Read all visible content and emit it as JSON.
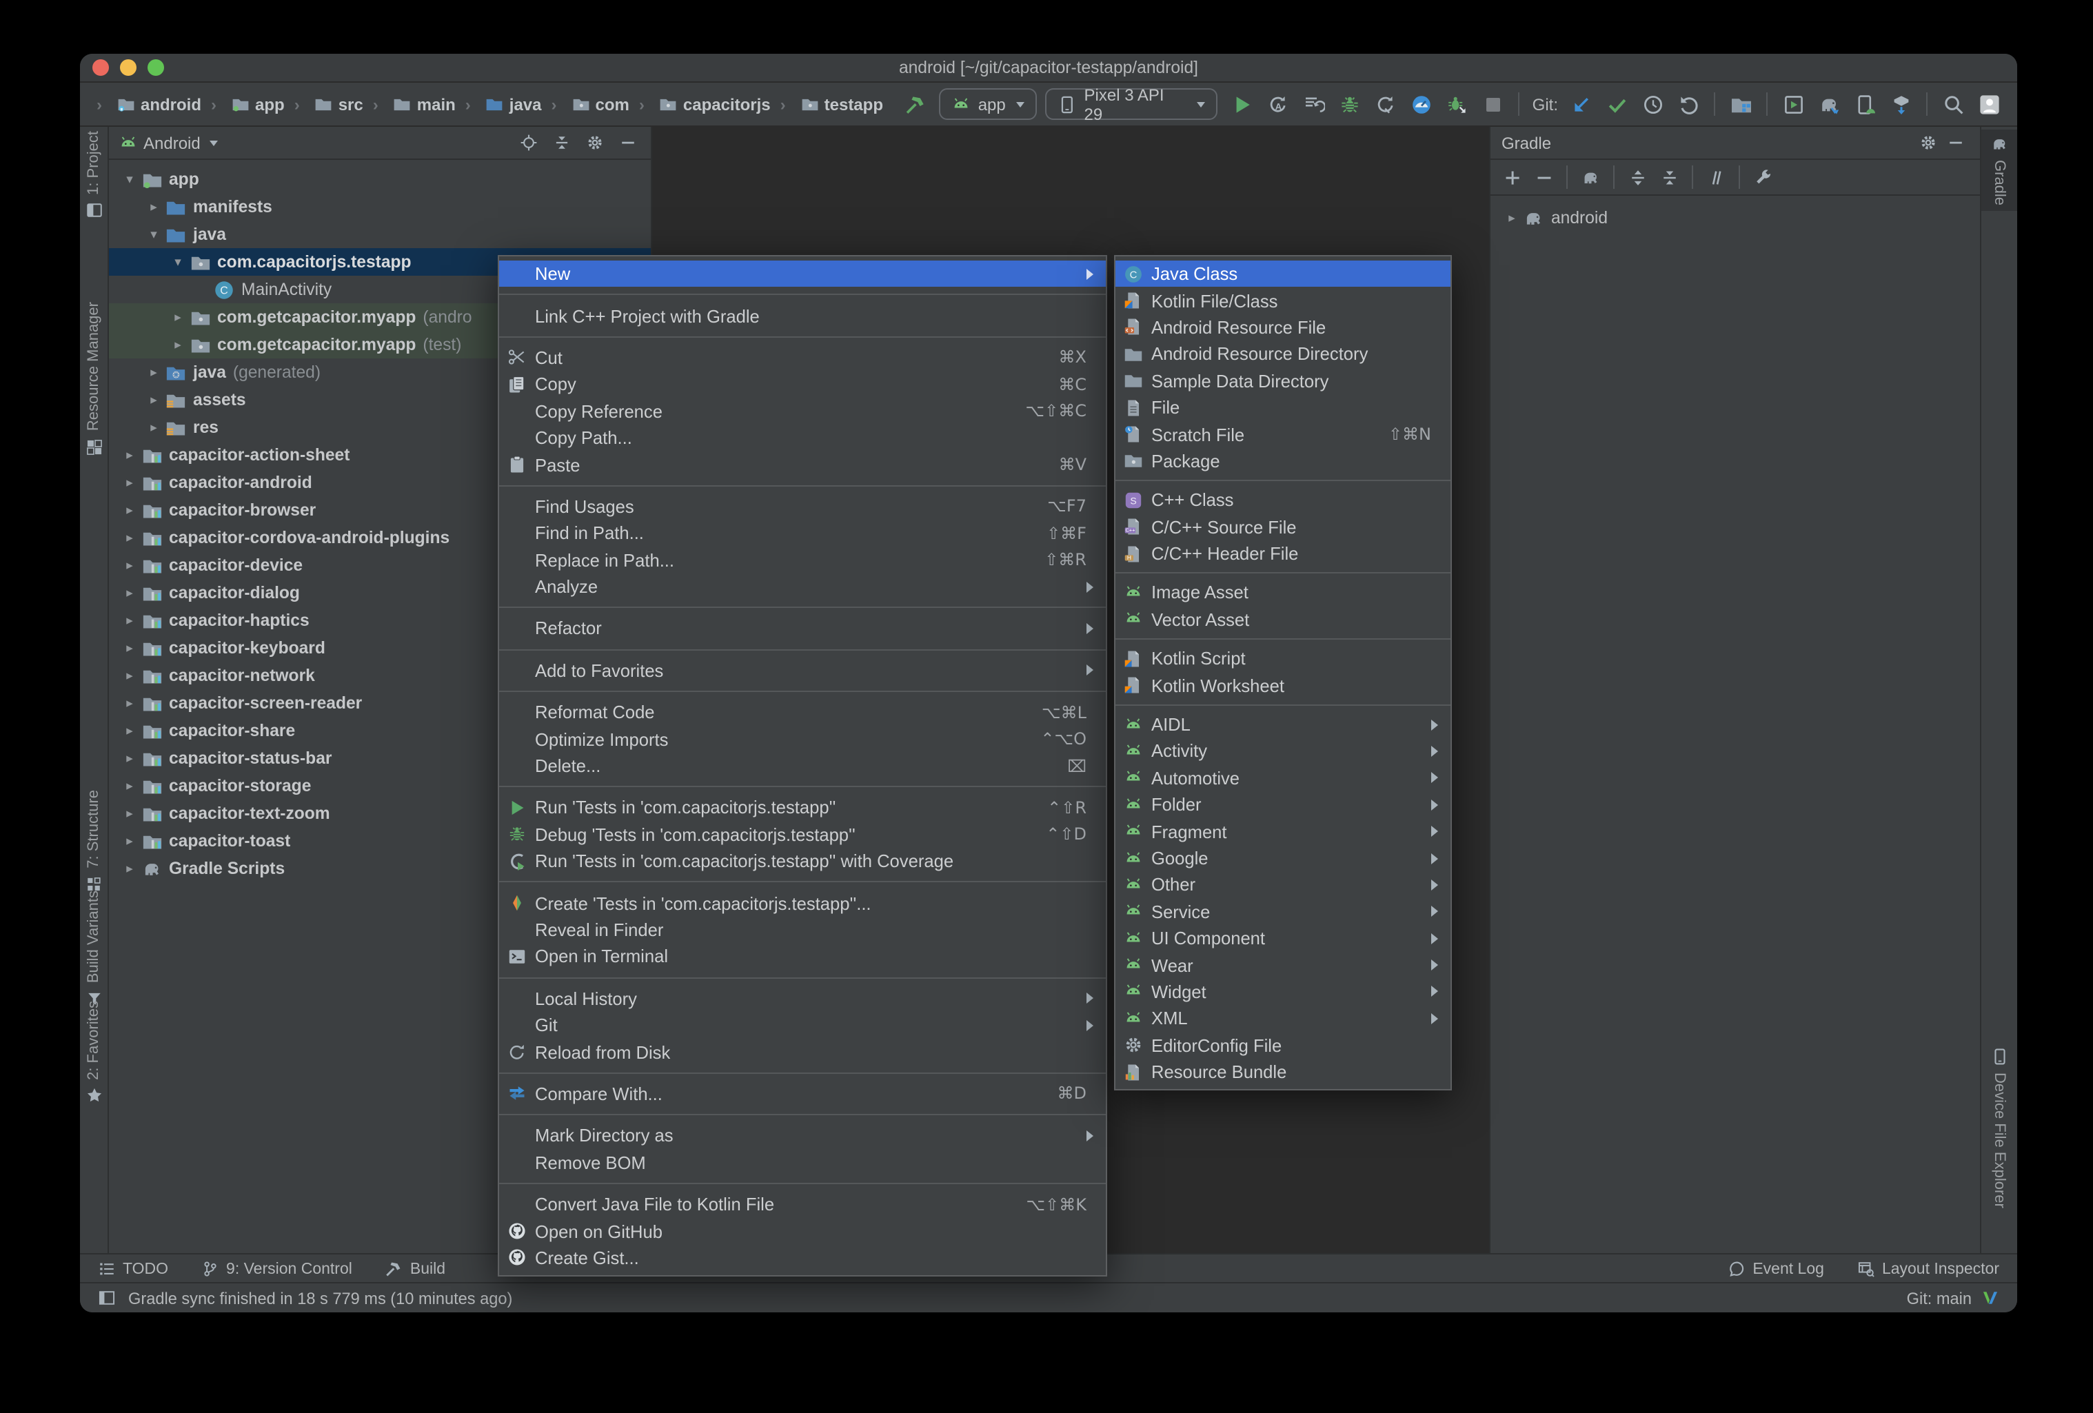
{
  "window": {
    "title": "android [~/git/capacitor-testapp/android]"
  },
  "colors": {
    "menu_selection": "#3a6bd0",
    "tree_selection": "#113150",
    "test_source_row": "#3f4a41",
    "run_green": "#59A869",
    "editor_bg": "#2b2b2b",
    "panel_bg": "#3c3f41"
  },
  "toolbar": {
    "breadcrumb": [
      {
        "icon": "folder-android",
        "label": "android"
      },
      {
        "icon": "folder-app",
        "label": "app"
      },
      {
        "icon": "folder",
        "label": "src"
      },
      {
        "icon": "folder",
        "label": "main"
      },
      {
        "icon": "folder-blue",
        "label": "java"
      },
      {
        "icon": "package",
        "label": "com"
      },
      {
        "icon": "package",
        "label": "capacitorjs"
      },
      {
        "icon": "package",
        "label": "testapp"
      }
    ],
    "run_config": "app",
    "device": "Pixel 3 API 29",
    "actions": [
      {
        "icon": "play",
        "name": "run-button"
      },
      {
        "icon": "apply-restart",
        "name": "apply-changes-restart-button"
      },
      {
        "icon": "apply-code",
        "name": "apply-code-changes-button"
      },
      {
        "icon": "debug",
        "name": "debug-button"
      },
      {
        "icon": "profiler-attach",
        "name": "attach-profiler-button"
      },
      {
        "icon": "profile",
        "name": "profile-button"
      },
      {
        "icon": "debug-attach",
        "name": "attach-debugger-button"
      },
      {
        "icon": "stop",
        "name": "stop-button"
      },
      {
        "type": "sep"
      },
      {
        "type": "label",
        "label": "Git:"
      },
      {
        "icon": "git-update",
        "name": "git-update-button"
      },
      {
        "icon": "git-commit",
        "name": "git-commit-button"
      },
      {
        "icon": "clock",
        "name": "git-history-button"
      },
      {
        "icon": "undo",
        "name": "git-rollback-button"
      },
      {
        "type": "sep"
      },
      {
        "icon": "sdk-folder",
        "name": "project-structure-button"
      },
      {
        "type": "sep"
      },
      {
        "icon": "device-manager",
        "name": "device-manager-button"
      },
      {
        "icon": "gradle-sync",
        "name": "gradle-sync-button"
      },
      {
        "icon": "avd-phone",
        "name": "avd-manager-button"
      },
      {
        "icon": "sdk-box",
        "name": "sdk-manager-button"
      },
      {
        "type": "sep"
      },
      {
        "icon": "search",
        "name": "search-everywhere-button"
      },
      {
        "icon": "avatar",
        "name": "avatar"
      }
    ]
  },
  "stripes": {
    "left": [
      {
        "icon": "project-tab",
        "label": "1: Project"
      },
      {
        "icon": "resource-manager",
        "label": "Resource Manager"
      },
      {
        "icon": "structure",
        "label": "7: Structure"
      },
      {
        "icon": "build-variants",
        "label": "Build Variants"
      },
      {
        "icon": "star",
        "label": "2: Favorites"
      }
    ],
    "right": [
      {
        "icon": "elephant",
        "label": "Gradle"
      },
      {
        "icon": "phone",
        "label": "Device File Explorer"
      }
    ]
  },
  "project_panel": {
    "view": "Android",
    "tree": [
      {
        "arrow": "▾",
        "icon": "folder-app",
        "label": "app",
        "bold": true,
        "level": 0
      },
      {
        "arrow": "▸",
        "icon": "folder-blue",
        "label": "manifests",
        "bold": true,
        "level": 1
      },
      {
        "arrow": "▾",
        "icon": "folder-blue",
        "label": "java",
        "bold": true,
        "level": 1
      },
      {
        "arrow": "▾",
        "icon": "package",
        "label": "com.capacitorjs.testapp",
        "bold": true,
        "level": 2,
        "selected": true
      },
      {
        "arrow": "",
        "icon": "class",
        "label": "MainActivity",
        "level": 3
      },
      {
        "arrow": "▸",
        "icon": "package",
        "label": "com.getcapacitor.myapp",
        "suffix": "(andro",
        "bold": true,
        "level": 2,
        "tinted": true
      },
      {
        "arrow": "▸",
        "icon": "package",
        "label": "com.getcapacitor.myapp",
        "suffix": "(test)",
        "bold": true,
        "level": 2,
        "tinted": true
      },
      {
        "arrow": "▸",
        "icon": "folder-gen",
        "label": "java",
        "suffix": "(generated)",
        "bold": true,
        "level": 1
      },
      {
        "arrow": "▸",
        "icon": "folder-res",
        "label": "assets",
        "bold": true,
        "level": 1
      },
      {
        "arrow": "▸",
        "icon": "folder-res",
        "label": "res",
        "bold": true,
        "level": 1
      },
      {
        "arrow": "▸",
        "icon": "module",
        "label": "capacitor-action-sheet",
        "bold": true,
        "level": 0
      },
      {
        "arrow": "▸",
        "icon": "module",
        "label": "capacitor-android",
        "bold": true,
        "level": 0
      },
      {
        "arrow": "▸",
        "icon": "module",
        "label": "capacitor-browser",
        "bold": true,
        "level": 0
      },
      {
        "arrow": "▸",
        "icon": "module",
        "label": "capacitor-cordova-android-plugins",
        "bold": true,
        "level": 0
      },
      {
        "arrow": "▸",
        "icon": "module",
        "label": "capacitor-device",
        "bold": true,
        "level": 0
      },
      {
        "arrow": "▸",
        "icon": "module",
        "label": "capacitor-dialog",
        "bold": true,
        "level": 0
      },
      {
        "arrow": "▸",
        "icon": "module",
        "label": "capacitor-haptics",
        "bold": true,
        "level": 0
      },
      {
        "arrow": "▸",
        "icon": "module",
        "label": "capacitor-keyboard",
        "bold": true,
        "level": 0
      },
      {
        "arrow": "▸",
        "icon": "module",
        "label": "capacitor-network",
        "bold": true,
        "level": 0
      },
      {
        "arrow": "▸",
        "icon": "module",
        "label": "capacitor-screen-reader",
        "bold": true,
        "level": 0
      },
      {
        "arrow": "▸",
        "icon": "module",
        "label": "capacitor-share",
        "bold": true,
        "level": 0
      },
      {
        "arrow": "▸",
        "icon": "module",
        "label": "capacitor-status-bar",
        "bold": true,
        "level": 0
      },
      {
        "arrow": "▸",
        "icon": "module",
        "label": "capacitor-storage",
        "bold": true,
        "level": 0
      },
      {
        "arrow": "▸",
        "icon": "module",
        "label": "capacitor-text-zoom",
        "bold": true,
        "level": 0
      },
      {
        "arrow": "▸",
        "icon": "module",
        "label": "capacitor-toast",
        "bold": true,
        "level": 0
      },
      {
        "arrow": "▸",
        "icon": "elephant",
        "label": "Gradle Scripts",
        "bold": true,
        "level": 0
      }
    ]
  },
  "gradle_panel": {
    "title": "Gradle",
    "root_arrow": "▸",
    "root": "android",
    "toolbar": [
      {
        "icon": "plus",
        "name": "gradle-add-button"
      },
      {
        "icon": "minus",
        "name": "gradle-remove-button"
      },
      {
        "type": "sep"
      },
      {
        "icon": "elephant",
        "name": "gradle-refresh-button"
      },
      {
        "type": "sep"
      },
      {
        "icon": "expand-all",
        "name": "expand-all-button"
      },
      {
        "icon": "collapse-all",
        "name": "collapse-all-button"
      },
      {
        "type": "sep"
      },
      {
        "icon": "split",
        "name": "toggle-offline-button"
      },
      {
        "type": "sep"
      },
      {
        "icon": "wrench",
        "name": "gradle-settings-button"
      }
    ]
  },
  "context_menu": {
    "items": [
      {
        "label": "New",
        "has_sub": true,
        "selected": true,
        "name": "menu-item-new"
      },
      {
        "type": "sep"
      },
      {
        "label": "Link C++ Project with Gradle"
      },
      {
        "type": "sep"
      },
      {
        "icon": "scissors",
        "label": "Cut",
        "shortcut": "⌘X"
      },
      {
        "icon": "copy",
        "label": "Copy",
        "shortcut": "⌘C"
      },
      {
        "label": "Copy Reference",
        "shortcut": "⌥⇧⌘C"
      },
      {
        "label": "Copy Path..."
      },
      {
        "icon": "paste",
        "label": "Paste",
        "shortcut": "⌘V"
      },
      {
        "type": "sep"
      },
      {
        "label": "Find Usages",
        "shortcut": "⌥F7"
      },
      {
        "label": "Find in Path...",
        "shortcut": "⇧⌘F"
      },
      {
        "label": "Replace in Path...",
        "shortcut": "⇧⌘R"
      },
      {
        "label": "Analyze",
        "has_sub": true
      },
      {
        "type": "sep"
      },
      {
        "label": "Refactor",
        "has_sub": true
      },
      {
        "type": "sep"
      },
      {
        "label": "Add to Favorites",
        "has_sub": true
      },
      {
        "type": "sep"
      },
      {
        "label": "Reformat Code",
        "shortcut": "⌥⌘L"
      },
      {
        "label": "Optimize Imports",
        "shortcut": "⌃⌥O"
      },
      {
        "label": "Delete...",
        "shortcut": "⌧"
      },
      {
        "type": "sep"
      },
      {
        "icon": "play",
        "label": "Run 'Tests in 'com.capacitorjs.testapp''",
        "shortcut": "⌃⇧R"
      },
      {
        "icon": "debug",
        "label": "Debug 'Tests in 'com.capacitorjs.testapp''",
        "shortcut": "⌃⇧D"
      },
      {
        "icon": "coverage",
        "label": "Run 'Tests in 'com.capacitorjs.testapp'' with Coverage"
      },
      {
        "type": "sep"
      },
      {
        "icon": "create-test",
        "label": "Create 'Tests in 'com.capacitorjs.testapp''..."
      },
      {
        "label": "Reveal in Finder"
      },
      {
        "icon": "terminal",
        "label": "Open in Terminal"
      },
      {
        "type": "sep"
      },
      {
        "label": "Local History",
        "has_sub": true
      },
      {
        "label": "Git",
        "has_sub": true
      },
      {
        "icon": "refresh",
        "label": "Reload from Disk"
      },
      {
        "type": "sep"
      },
      {
        "icon": "compare",
        "label": "Compare With...",
        "shortcut": "⌘D"
      },
      {
        "type": "sep"
      },
      {
        "label": "Mark Directory as",
        "has_sub": true
      },
      {
        "label": "Remove BOM"
      },
      {
        "type": "sep"
      },
      {
        "label": "Convert Java File to Kotlin File",
        "shortcut": "⌥⇧⌘K"
      },
      {
        "icon": "github",
        "label": "Open on GitHub"
      },
      {
        "icon": "github",
        "label": "Create Gist..."
      }
    ]
  },
  "submenu": {
    "items": [
      {
        "icon": "class",
        "label": "Java Class",
        "selected": true,
        "name": "submenu-item-java-class"
      },
      {
        "icon": "kotlin-file",
        "label": "Kotlin File/Class"
      },
      {
        "icon": "res-file",
        "label": "Android Resource File"
      },
      {
        "icon": "folder",
        "label": "Android Resource Directory"
      },
      {
        "icon": "folder",
        "label": "Sample Data Directory"
      },
      {
        "icon": "file",
        "label": "File"
      },
      {
        "icon": "scratch-file",
        "label": "Scratch File",
        "shortcut": "⇧⌘N"
      },
      {
        "icon": "package",
        "label": "Package"
      },
      {
        "type": "sep"
      },
      {
        "icon": "cpp-class",
        "label": "C++ Class"
      },
      {
        "icon": "cpp-source",
        "label": "C/C++ Source File"
      },
      {
        "icon": "cpp-header",
        "label": "C/C++ Header File"
      },
      {
        "type": "sep"
      },
      {
        "icon": "android-head",
        "label": "Image Asset"
      },
      {
        "icon": "android-head",
        "label": "Vector Asset"
      },
      {
        "type": "sep"
      },
      {
        "icon": "kotlin-script",
        "label": "Kotlin Script"
      },
      {
        "icon": "kotlin-script",
        "label": "Kotlin Worksheet"
      },
      {
        "type": "sep"
      },
      {
        "icon": "android-head",
        "label": "AIDL",
        "has_sub": true
      },
      {
        "icon": "android-head",
        "label": "Activity",
        "has_sub": true
      },
      {
        "icon": "android-head",
        "label": "Automotive",
        "has_sub": true
      },
      {
        "icon": "android-head",
        "label": "Folder",
        "has_sub": true
      },
      {
        "icon": "android-head",
        "label": "Fragment",
        "has_sub": true
      },
      {
        "icon": "android-head",
        "label": "Google",
        "has_sub": true
      },
      {
        "icon": "android-head",
        "label": "Other",
        "has_sub": true
      },
      {
        "icon": "android-head",
        "label": "Service",
        "has_sub": true
      },
      {
        "icon": "android-head",
        "label": "UI Component",
        "has_sub": true
      },
      {
        "icon": "android-head",
        "label": "Wear",
        "has_sub": true
      },
      {
        "icon": "android-head",
        "label": "Widget",
        "has_sub": true
      },
      {
        "icon": "android-head",
        "label": "XML",
        "has_sub": true
      },
      {
        "icon": "gear",
        "label": "EditorConfig File"
      },
      {
        "icon": "resource-bundle",
        "label": "Resource Bundle"
      }
    ]
  },
  "bottom_bar": {
    "left": [
      {
        "icon": "todo",
        "label": "TODO"
      },
      {
        "icon": "branch",
        "label": "9: Version Control"
      },
      {
        "icon": "hammer-gray",
        "label": "Build"
      }
    ],
    "right": [
      {
        "icon": "balloon",
        "label": "Event Log"
      },
      {
        "icon": "layout-inspector",
        "label": "Layout Inspector"
      }
    ]
  },
  "status_bar": {
    "message": "Gradle sync finished in 18 s 779 ms (10 minutes ago)",
    "git": "Git: main"
  }
}
